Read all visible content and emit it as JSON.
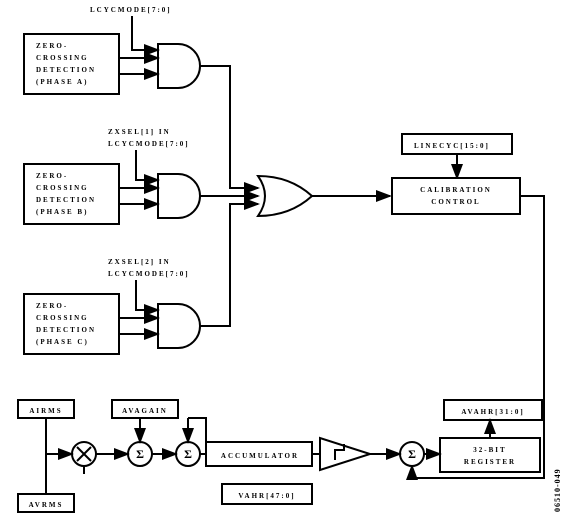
{
  "top": {
    "lcycmode_label": "LCYCMODE[7:0]",
    "phaseA_box": "ZERO-\nCROSSING\nDETECTION\n(PHASE A)",
    "phaseB_box": "ZERO-\nCROSSING\nDETECTION\n(PHASE B)",
    "phaseC_box": "ZERO-\nCROSSING\nDETECTION\n(PHASE C)",
    "zxsel1_label": "ZXSEL[1] IN\nLCYCMODE[7:0]",
    "zxsel2_label": "ZXSEL[2] IN\nLCYCMODE[7:0]",
    "linecyc_label": "LINECYC[15:0]",
    "cal_box": "CALIBRATION\nCONTROL"
  },
  "bottom": {
    "airms_label": "AIRMS",
    "avrms_label": "AVRMS",
    "avagain_label": "AVAGAIN",
    "accumulator_label": "ACCUMULATOR",
    "vahr_label": "VAHR[47:0]",
    "avahr_label": "AVAHR[31:0]",
    "reg32_label": "32-BIT\nREGISTER"
  },
  "fig_id": "06510-049"
}
